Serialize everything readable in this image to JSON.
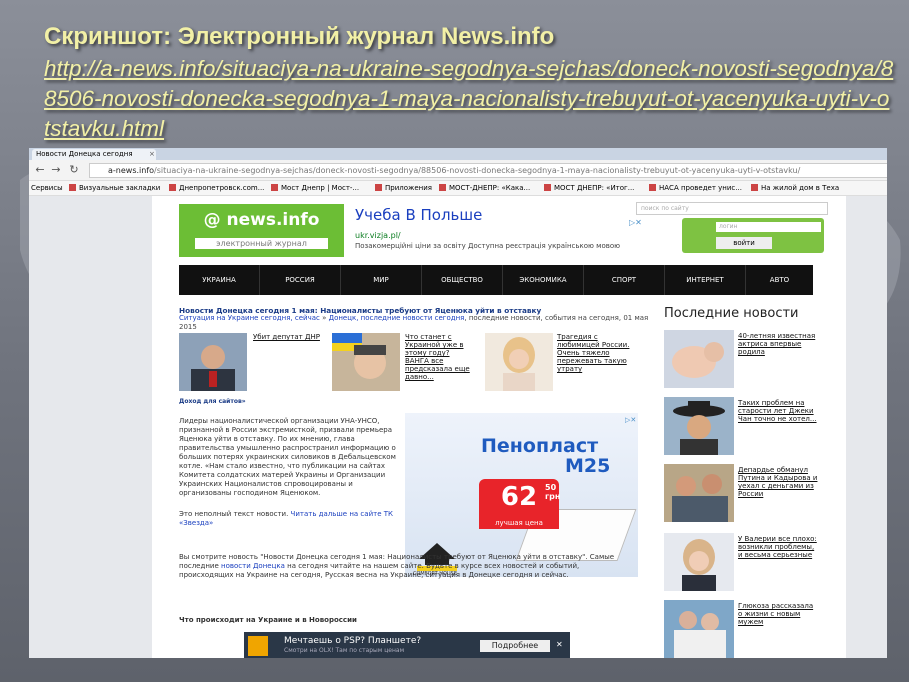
{
  "slide": {
    "title": "Скриншот: Электронный журнал News.info",
    "link": "http://a-news.info/situaciya-na-ukraine-segodnya-sejchas/doneck-novosti-segodnya/88506-novosti-donecka-segodnya-1-maya-nacionalisty-trebuyut-ot-yacenyuka-uyti-v-otstavku.html"
  },
  "browser": {
    "tab_title": "Новости Донецка сегодня",
    "url_host": "a-news.info",
    "url_path": "/situaciya-na-ukraine-segodnya-sejchas/doneck-novosti-segodnya/88506-novosti-donecka-segodnya-1-maya-nacionalisty-trebuyut-ot-yacenyuka-uyti-v-otstavku/",
    "bookmarks": [
      "Сервисы",
      "Визуальные закладки",
      "Днепропетровск.com...",
      "Мост Днепр | Мост-...",
      "Приложения",
      "МОСТ-ДНЕПР: «Кака...",
      "МОСТ ДНЕПР: «Итог...",
      "НАСА проведет унис...",
      "На жилой дом в Теха"
    ]
  },
  "site": {
    "logo_text": "news.info",
    "logo_sub": "электронный журнал",
    "ad_title": "Учеба В Польше",
    "ad_url": "ukr.vizja.pl/",
    "ad_desc": "Позакомерційні ціни за освіту Доступна реєстрація українською мовою",
    "search_placeholder": "поиск по сайту",
    "login_placeholder": "логин",
    "login_button": "войти",
    "menu": [
      "УКРАИНА",
      "РОССИЯ",
      "МИР",
      "ОБЩЕСТВО",
      "ЭКОНОМИКА",
      "СПОРТ",
      "ИНТЕРНЕТ",
      "АВТО"
    ]
  },
  "article": {
    "headline": "Новости Донецка сегодня 1 мая: Националисты требуют от Яценюка уйти в отставку",
    "bc_link1": "Ситуация на Украине сегодня, сейчас",
    "bc_sep": " » ",
    "bc_link2": "Донецк, последние новости сегодня",
    "bc_rest": ", последние новости, события на сегодня, 01 мая 2015",
    "thumbs": [
      {
        "text": "Убит депутат ДНР"
      },
      {
        "text": "Что станет с Украиной уже в этому году? ВАНГА все предсказала еще давно..."
      },
      {
        "text": "Трагедия с любимицей России. Очень тяжело пережевать такую утрату"
      }
    ],
    "income_link": "Доход для сайтов»",
    "body": "Лидеры националистической организации УНА-УНСО, признанной в России экстремисткой, призвали премьера Яценюка уйти в отставку. По их мнению, глава правительства умышленно распространил информацию о больших потерях украинских силовиков в Дебальцевском котле. «Нам стало известно, что публикации на сайтах Комитета солдатских матерей Украины и Организации Украинских Националистов спровоцированы и организованы господином Яценюком.",
    "more_pre": "Это неполный текст новости. ",
    "more_link": "Читать дальше на сайте ТК «Звезда»",
    "bottom_pre": "Вы смотрите новость \"Новости Донецка сегодня 1 мая: Националисты требуют от Яценюка уйти в отставку\". Самые последние ",
    "bottom_link": "новости Донецка",
    "bottom_post": " на сегодня читайте на нашем сайте. Будьте в курсе всех новостей и событий, происходящих на Украине на сегодня, Русская весна на Украине, ситуация в Донецке сегодня и сейчас.",
    "section": "Что происходит на Украине и в Новороссии"
  },
  "banner": {
    "title1": "Пенопласт",
    "title2": "М25",
    "price": "62",
    "cents": "50",
    "unit": "грн",
    "best": "лучшая цена",
    "brand": "COMFORT HOUSE"
  },
  "sidebar": {
    "title": "Последние новости",
    "items": [
      {
        "text": "40-летняя известная актриса впервые родила"
      },
      {
        "text": "Таких проблем на старости лет Джеки Чан точно не хотел..."
      },
      {
        "text": "Депардье обманул Путина и Кадырова и уехал с деньгами из России"
      },
      {
        "text": "У Валерии все плохо: возникли проблемы, и весьма серьезные"
      },
      {
        "text": "Глюкоза рассказала о жизни с новым мужем"
      }
    ]
  },
  "psp_ad": {
    "title": "Мечтаешь о PSP? Планшете?",
    "sub": "Смотри на OLX! Там по старым ценам",
    "button": "Подробнее"
  }
}
